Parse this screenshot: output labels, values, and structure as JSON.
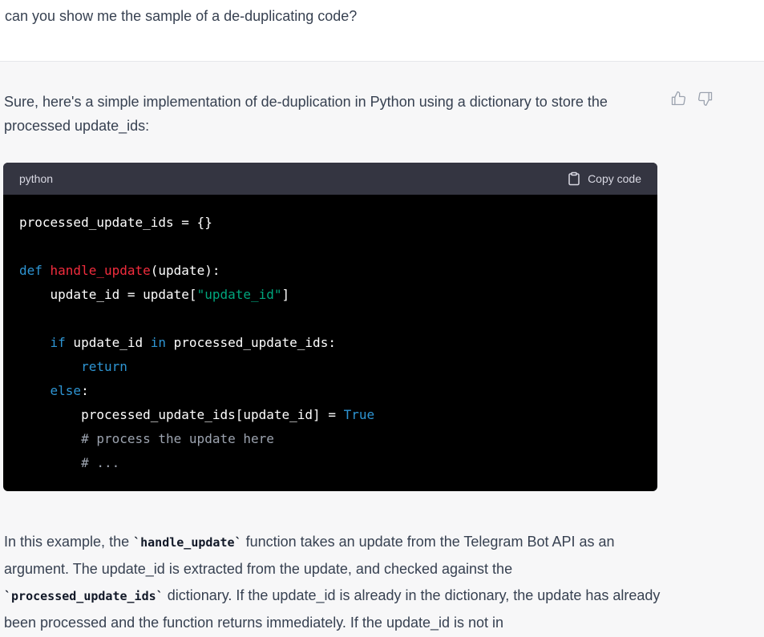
{
  "user": {
    "message": "can you show me the sample of a de-duplicating code?"
  },
  "assistant": {
    "intro": "Sure, here's a simple implementation of de-duplication in Python using a dictionary to store the processed update_ids:",
    "code": {
      "language": "python",
      "copy_label": "Copy code",
      "lines": [
        {
          "indent": "",
          "parts": [
            {
              "t": "processed_update_ids = {}",
              "c": ""
            }
          ]
        },
        {
          "indent": "",
          "parts": []
        },
        {
          "indent": "",
          "parts": [
            {
              "t": "def ",
              "c": "k"
            },
            {
              "t": "handle_update",
              "c": "f"
            },
            {
              "t": "(update):",
              "c": ""
            }
          ]
        },
        {
          "indent": "    ",
          "parts": [
            {
              "t": "update_id = update[",
              "c": ""
            },
            {
              "t": "\"update_id\"",
              "c": "s"
            },
            {
              "t": "]",
              "c": ""
            }
          ]
        },
        {
          "indent": "",
          "parts": []
        },
        {
          "indent": "    ",
          "parts": [
            {
              "t": "if",
              "c": "k"
            },
            {
              "t": " update_id ",
              "c": ""
            },
            {
              "t": "in",
              "c": "k"
            },
            {
              "t": " processed_update_ids:",
              "c": ""
            }
          ]
        },
        {
          "indent": "        ",
          "parts": [
            {
              "t": "return",
              "c": "k"
            }
          ]
        },
        {
          "indent": "    ",
          "parts": [
            {
              "t": "else",
              "c": "k"
            },
            {
              "t": ":",
              "c": ""
            }
          ]
        },
        {
          "indent": "        ",
          "parts": [
            {
              "t": "processed_update_ids[update_id] = ",
              "c": ""
            },
            {
              "t": "True",
              "c": "b"
            }
          ]
        },
        {
          "indent": "        ",
          "parts": [
            {
              "t": "# process the update here",
              "c": "c"
            }
          ]
        },
        {
          "indent": "        ",
          "parts": [
            {
              "t": "# ...",
              "c": "c"
            }
          ]
        }
      ]
    },
    "outro": {
      "p1": "In this example, the ",
      "code1": "`handle_update`",
      "p2": " function takes an update from the Telegram Bot API as an argument. The update_id is extracted from the update, and checked against the ",
      "code2": "`processed_update_ids`",
      "p3": " dictionary. If the update_id is already in the dictionary, the update has already been processed and the function returns immediately. If the update_id is not in"
    }
  },
  "colors": {
    "keyword": "#2e95d3",
    "function": "#f22c3d",
    "string": "#00a67d",
    "comment": "#9ca3af",
    "code_bg": "#000000",
    "code_header_bg": "#343541",
    "assistant_bg": "#f7f7f8"
  },
  "icons": [
    "thumbs-up-icon",
    "thumbs-down-icon",
    "clipboard-icon"
  ]
}
